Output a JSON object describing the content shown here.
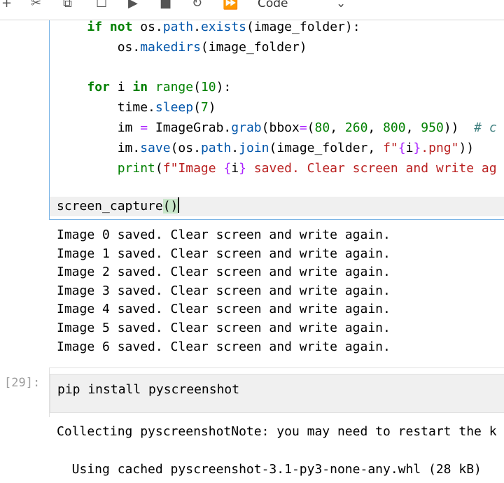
{
  "toolbar": {
    "buttons": [
      {
        "icon": "plus-icon",
        "glyph": "+"
      },
      {
        "icon": "scissors-icon",
        "glyph": "✂"
      },
      {
        "icon": "copy-icon",
        "glyph": "⧉"
      },
      {
        "icon": "paste-icon",
        "glyph": "☐"
      },
      {
        "icon": "run-icon",
        "glyph": "▶"
      },
      {
        "icon": "stop-icon",
        "glyph": "■"
      },
      {
        "icon": "restart-icon",
        "glyph": "↻"
      },
      {
        "icon": "fast-forward-icon",
        "glyph": "⏩"
      }
    ],
    "cell_type": "Code"
  },
  "cell1": {
    "lines": [
      "    if not os.path.exists(image_folder):",
      "        os.makedirs(image_folder)",
      "",
      "    for i in range(10):",
      "        time.sleep(7)",
      "        im = ImageGrab.grab(bbox=(80, 260, 800, 950))  # c",
      "        im.save(os.path.join(image_folder, f\"{i}.png\"))",
      "        print(f\"Image {i} saved. Clear screen and write ag"
    ],
    "call_line": "screen_capture()"
  },
  "output1": [
    "Image 0 saved. Clear screen and write again.",
    "Image 1 saved. Clear screen and write again.",
    "Image 2 saved. Clear screen and write again.",
    "Image 3 saved. Clear screen and write again.",
    "Image 4 saved. Clear screen and write again.",
    "Image 5 saved. Clear screen and write again.",
    "Image 6 saved. Clear screen and write again."
  ],
  "cell29": {
    "prompt": "[29]:",
    "source": "pip install pyscreenshot"
  },
  "output29": [
    "Collecting pyscreenshotNote: you may need to restart the k",
    "",
    "  Using cached pyscreenshot-3.1-py3-none-any.whl (28 kB)"
  ]
}
